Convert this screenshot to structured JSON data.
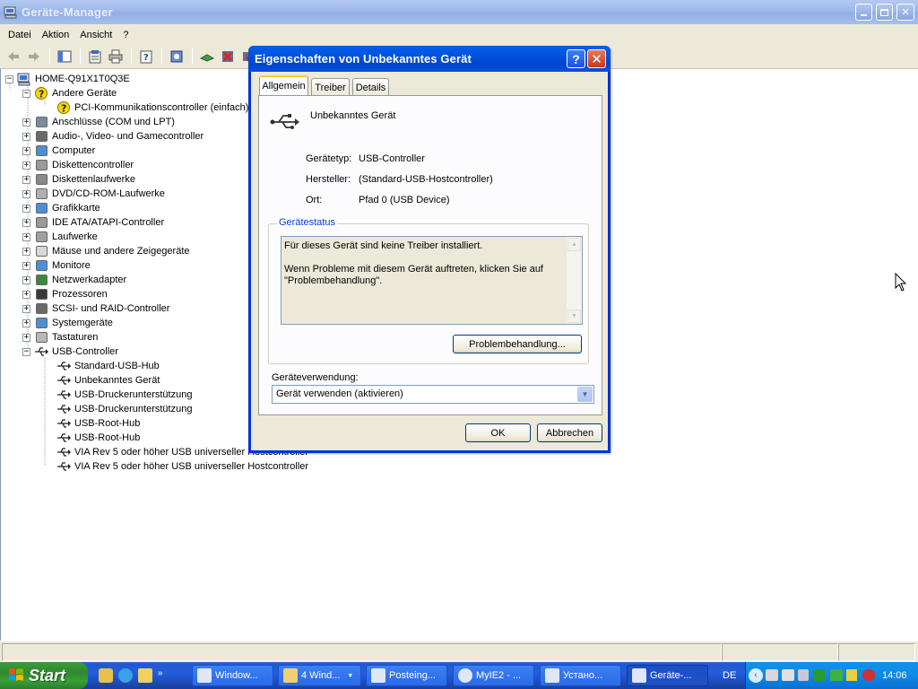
{
  "window": {
    "title": "Geräte-Manager"
  },
  "menu": [
    "Datei",
    "Aktion",
    "Ansicht",
    "?"
  ],
  "tree": {
    "root": "HOME-Q91X1T0Q3E",
    "items": [
      {
        "label": "Andere Geräte",
        "level": 1,
        "expanded": true,
        "icon": "question-device-icon"
      },
      {
        "label": "PCI-Kommunikationscontroller (einfach)",
        "level": 2,
        "icon": "warning-device-icon"
      },
      {
        "label": "Anschlüsse (COM und LPT)",
        "level": 1,
        "icon": "port-icon"
      },
      {
        "label": "Audio-, Video- und Gamecontroller",
        "level": 1,
        "icon": "speaker-icon"
      },
      {
        "label": "Computer",
        "level": 1,
        "icon": "computer-icon"
      },
      {
        "label": "Diskettencontroller",
        "level": 1,
        "icon": "controller-icon"
      },
      {
        "label": "Diskettenlaufwerke",
        "level": 1,
        "icon": "floppy-icon"
      },
      {
        "label": "DVD/CD-ROM-Laufwerke",
        "level": 1,
        "icon": "cdrom-icon"
      },
      {
        "label": "Grafikkarte",
        "level": 1,
        "icon": "display-adapter-icon"
      },
      {
        "label": "IDE ATA/ATAPI-Controller",
        "level": 1,
        "icon": "controller-icon"
      },
      {
        "label": "Laufwerke",
        "level": 1,
        "icon": "drive-icon"
      },
      {
        "label": "Mäuse und andere Zeigegeräte",
        "level": 1,
        "icon": "mouse-icon"
      },
      {
        "label": "Monitore",
        "level": 1,
        "icon": "monitor-icon"
      },
      {
        "label": "Netzwerkadapter",
        "level": 1,
        "icon": "network-icon"
      },
      {
        "label": "Prozessoren",
        "level": 1,
        "icon": "cpu-icon"
      },
      {
        "label": "SCSI- und RAID-Controller",
        "level": 1,
        "icon": "scsi-icon"
      },
      {
        "label": "Systemgeräte",
        "level": 1,
        "icon": "system-icon"
      },
      {
        "label": "Tastaturen",
        "level": 1,
        "icon": "keyboard-icon"
      },
      {
        "label": "USB-Controller",
        "level": 1,
        "expanded": true,
        "icon": "usb-icon"
      },
      {
        "label": "Standard-USB-Hub",
        "level": 2,
        "icon": "usb-icon"
      },
      {
        "label": "Unbekanntes Gerät",
        "level": 2,
        "icon": "usb-icon"
      },
      {
        "label": "USB-Druckerunterstützung",
        "level": 2,
        "icon": "usb-icon"
      },
      {
        "label": "USB-Druckerunterstützung",
        "level": 2,
        "icon": "usb-icon"
      },
      {
        "label": "USB-Root-Hub",
        "level": 2,
        "icon": "usb-icon"
      },
      {
        "label": "USB-Root-Hub",
        "level": 2,
        "icon": "usb-icon"
      },
      {
        "label": "VIA Rev 5 oder höher USB universeller Hostcontroller",
        "level": 2,
        "icon": "usb-icon"
      },
      {
        "label": "VIA Rev 5 oder höher USB universeller Hostcontroller",
        "level": 2,
        "icon": "usb-icon"
      }
    ]
  },
  "dialog": {
    "title": "Eigenschaften von Unbekanntes Gerät",
    "help": "?",
    "tabs": [
      "Allgemein",
      "Treiber",
      "Details"
    ],
    "device_name": "Unbekanntes Gerät",
    "props": [
      {
        "label": "Gerätetyp:",
        "value": "USB-Controller"
      },
      {
        "label": "Hersteller:",
        "value": "(Standard-USB-Hostcontroller)"
      },
      {
        "label": "Ort:",
        "value": "Pfad 0 (USB Device)"
      }
    ],
    "status_group": "Gerätestatus",
    "status_text": "Für dieses Gerät sind keine Treiber installiert.\n\nWenn Probleme mit diesem Gerät auftreten, klicken Sie auf \"Problembehandlung\".",
    "troubleshoot_button": "Problembehandlung...",
    "usage_label": "Geräteverwendung:",
    "usage_value": "Gerät verwenden (aktivieren)",
    "ok": "OK",
    "cancel": "Abbrechen"
  },
  "taskbar": {
    "start": "Start",
    "tasks": [
      "Window...",
      "4 Wind...",
      "Posteing...",
      "MyIE2 - ...",
      "Устано...",
      "Geräte-..."
    ],
    "language": "DE",
    "clock": "14:06"
  }
}
